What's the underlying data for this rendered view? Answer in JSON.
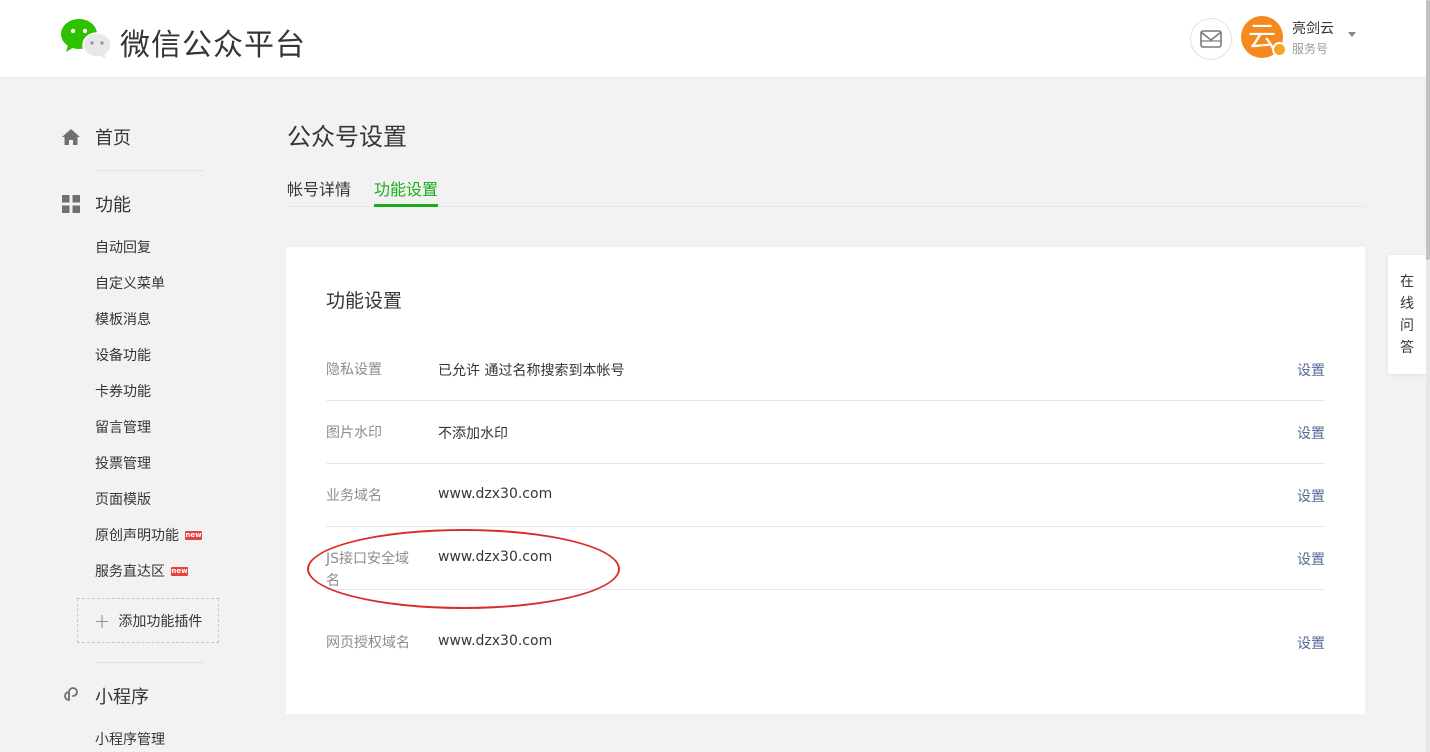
{
  "header": {
    "logo_text": "微信公众平台",
    "account": {
      "avatar_char": "云",
      "name": "亮剑云",
      "type": "服务号"
    }
  },
  "sidebar": {
    "home": "首页",
    "func": "功能",
    "items": [
      {
        "label": "自动回复",
        "is_new": false
      },
      {
        "label": "自定义菜单",
        "is_new": false
      },
      {
        "label": "模板消息",
        "is_new": false
      },
      {
        "label": "设备功能",
        "is_new": false
      },
      {
        "label": "卡券功能",
        "is_new": false
      },
      {
        "label": "留言管理",
        "is_new": false
      },
      {
        "label": "投票管理",
        "is_new": false
      },
      {
        "label": "页面模版",
        "is_new": false
      },
      {
        "label": "原创声明功能",
        "is_new": true
      },
      {
        "label": "服务直达区",
        "is_new": true
      }
    ],
    "new_tag": "new",
    "add_plugin": "添加功能插件",
    "mini": "小程序",
    "mini_items": [
      {
        "label": "小程序管理"
      }
    ]
  },
  "main": {
    "page_title": "公众号设置",
    "tabs": [
      {
        "label": "帐号详情",
        "active": false
      },
      {
        "label": "功能设置",
        "active": true
      }
    ],
    "card_title": "功能设置",
    "rows": [
      {
        "label": "隐私设置",
        "value": "已允许 通过名称搜索到本帐号",
        "action": "设置"
      },
      {
        "label": "图片水印",
        "value": "不添加水印",
        "action": "设置"
      },
      {
        "label": "业务域名",
        "value": "www.dzx30.com",
        "action": "设置"
      },
      {
        "label": "JS接口安全域名",
        "value": "www.dzx30.com",
        "action": "设置"
      },
      {
        "label": "网页授权域名",
        "value": "www.dzx30.com",
        "action": "设置"
      }
    ]
  },
  "float": {
    "online_qa": [
      "在",
      "线",
      "问",
      "答"
    ]
  },
  "colors": {
    "accent_green": "#1aad19",
    "link_blue": "#576b95",
    "annotation_red": "#d92c2c",
    "avatar_orange": "#f5891f"
  }
}
